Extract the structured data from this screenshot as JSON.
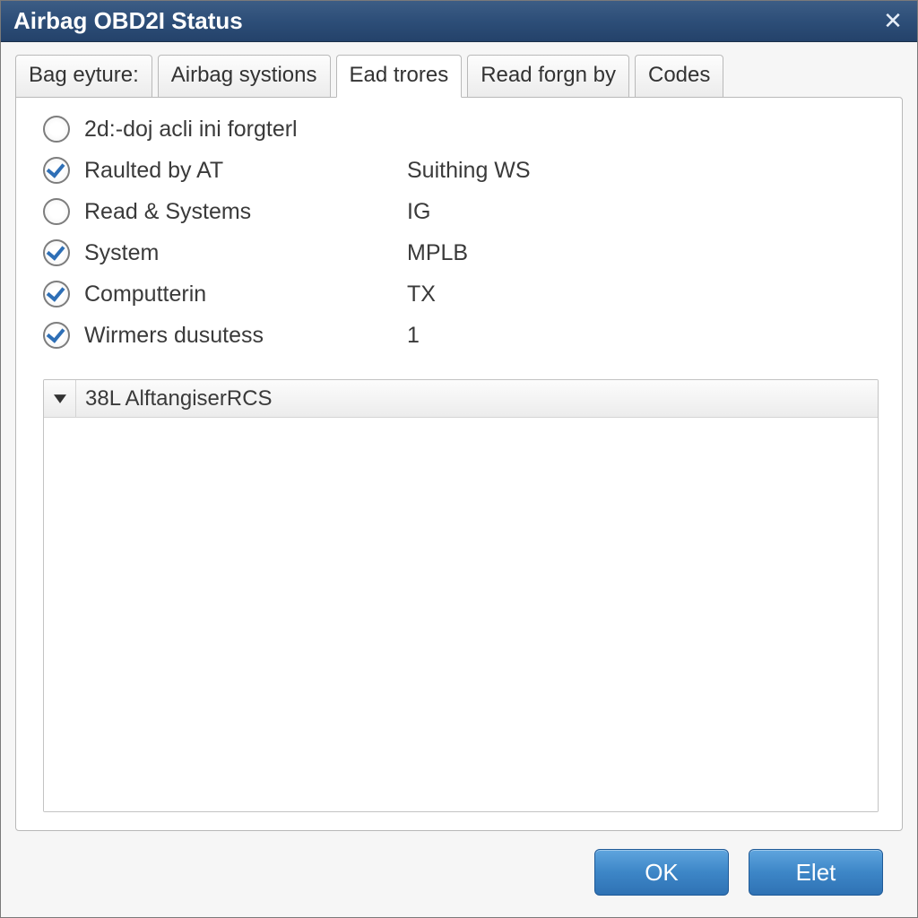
{
  "window": {
    "title": "Airbag OBD2I Status",
    "close_glyph": "✕"
  },
  "tabs": [
    {
      "label": "Bag eyture:",
      "active": false
    },
    {
      "label": "Airbag systions",
      "active": false
    },
    {
      "label": "Ead trores",
      "active": true
    },
    {
      "label": "Read forgn by",
      "active": false
    },
    {
      "label": "Codes",
      "active": false
    }
  ],
  "options": [
    {
      "checked": false,
      "label": "2d:-doj acli ini forgterl",
      "value": ""
    },
    {
      "checked": true,
      "label": "Raulted by AT",
      "value": "Suithing WS"
    },
    {
      "checked": false,
      "label": "Read & Systems",
      "value": "IG"
    },
    {
      "checked": true,
      "label": "System",
      "value": "MPLB"
    },
    {
      "checked": true,
      "label": "Computterin",
      "value": "TX"
    },
    {
      "checked": true,
      "label": "Wirmers dusutess",
      "value": "1"
    }
  ],
  "dropdown": {
    "selected": "38L AlftangiserRCS"
  },
  "buttons": {
    "ok": "OK",
    "elet": "Elet"
  }
}
